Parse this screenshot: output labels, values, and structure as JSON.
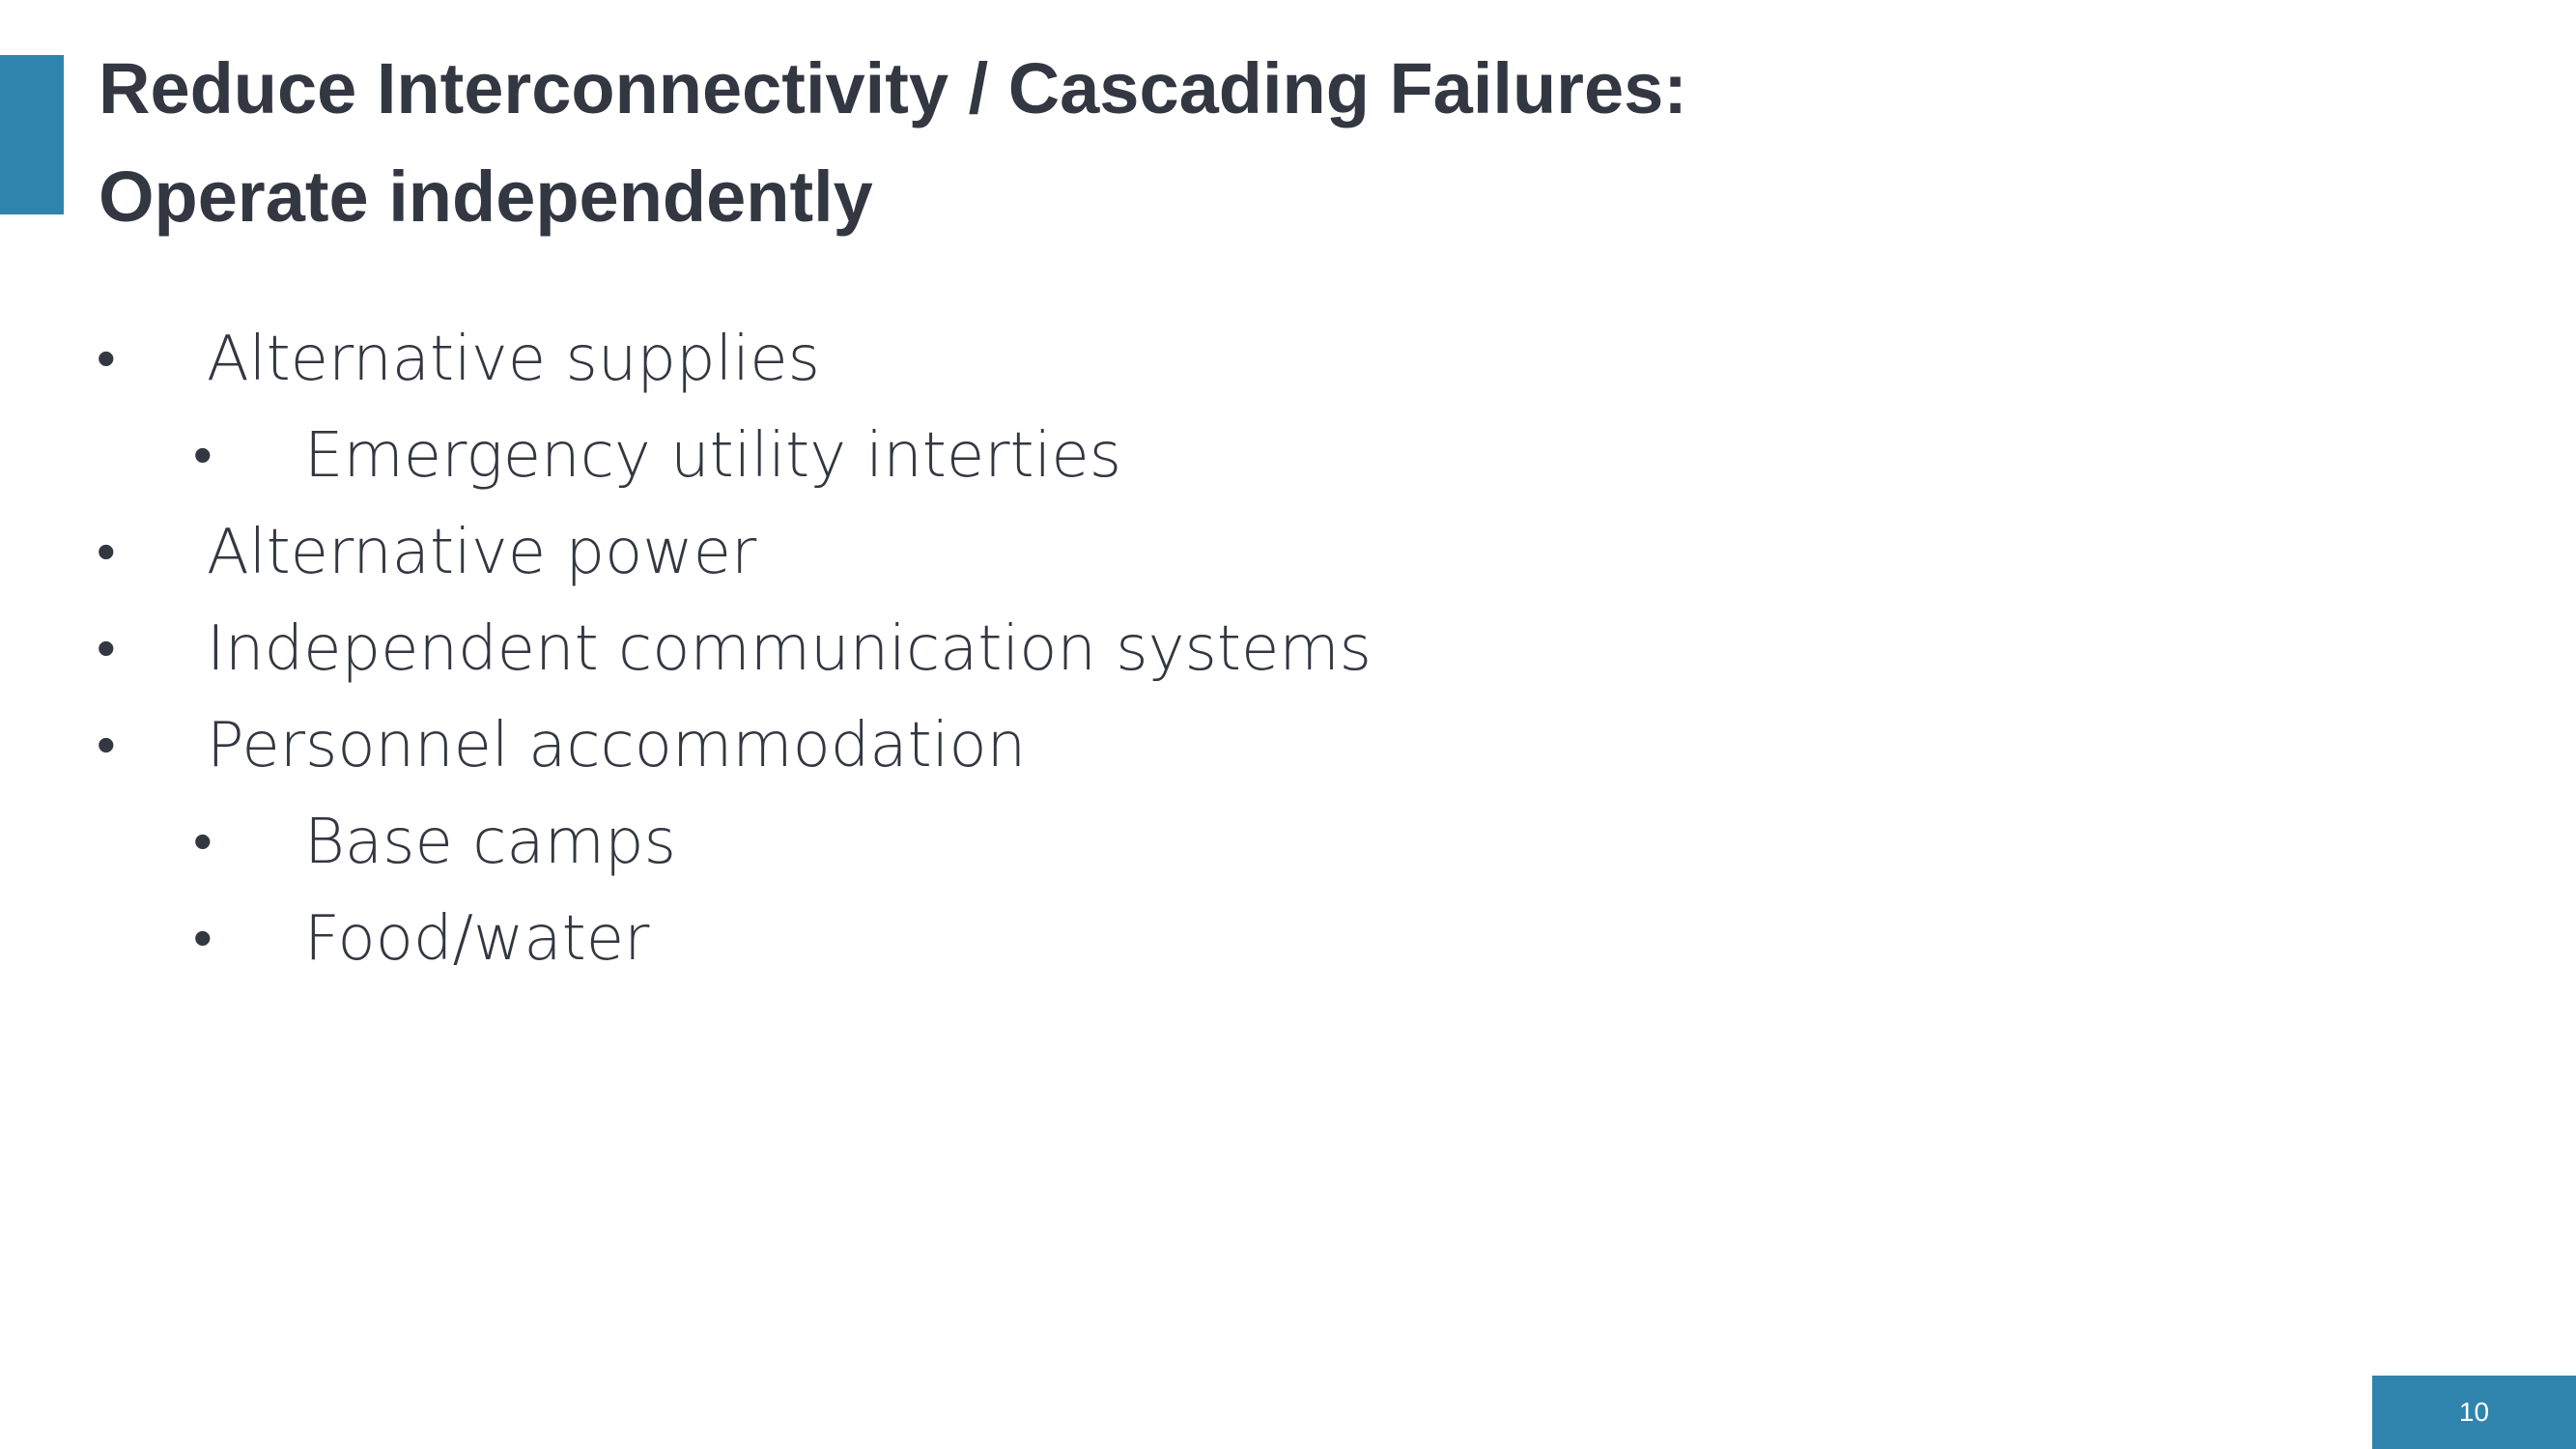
{
  "slide": {
    "title_lines": [
      "Reduce Interconnectivity / Cascading Failures:",
      "Operate independently"
    ],
    "bullets": [
      {
        "level": 1,
        "text": "Alternative supplies"
      },
      {
        "level": 2,
        "text": "Emergency utility interties"
      },
      {
        "level": 1,
        "text": "Alternative power"
      },
      {
        "level": 1,
        "text": "Independent communication systems"
      },
      {
        "level": 1,
        "text": "Personnel accommodation"
      },
      {
        "level": 2,
        "text": "Base camps"
      },
      {
        "level": 2,
        "text": "Food/water"
      }
    ],
    "bullet_glyph": "•",
    "page_number": "10"
  },
  "colors": {
    "accent": "#2f84ad",
    "text": "#333741",
    "background": "#ffffff"
  }
}
